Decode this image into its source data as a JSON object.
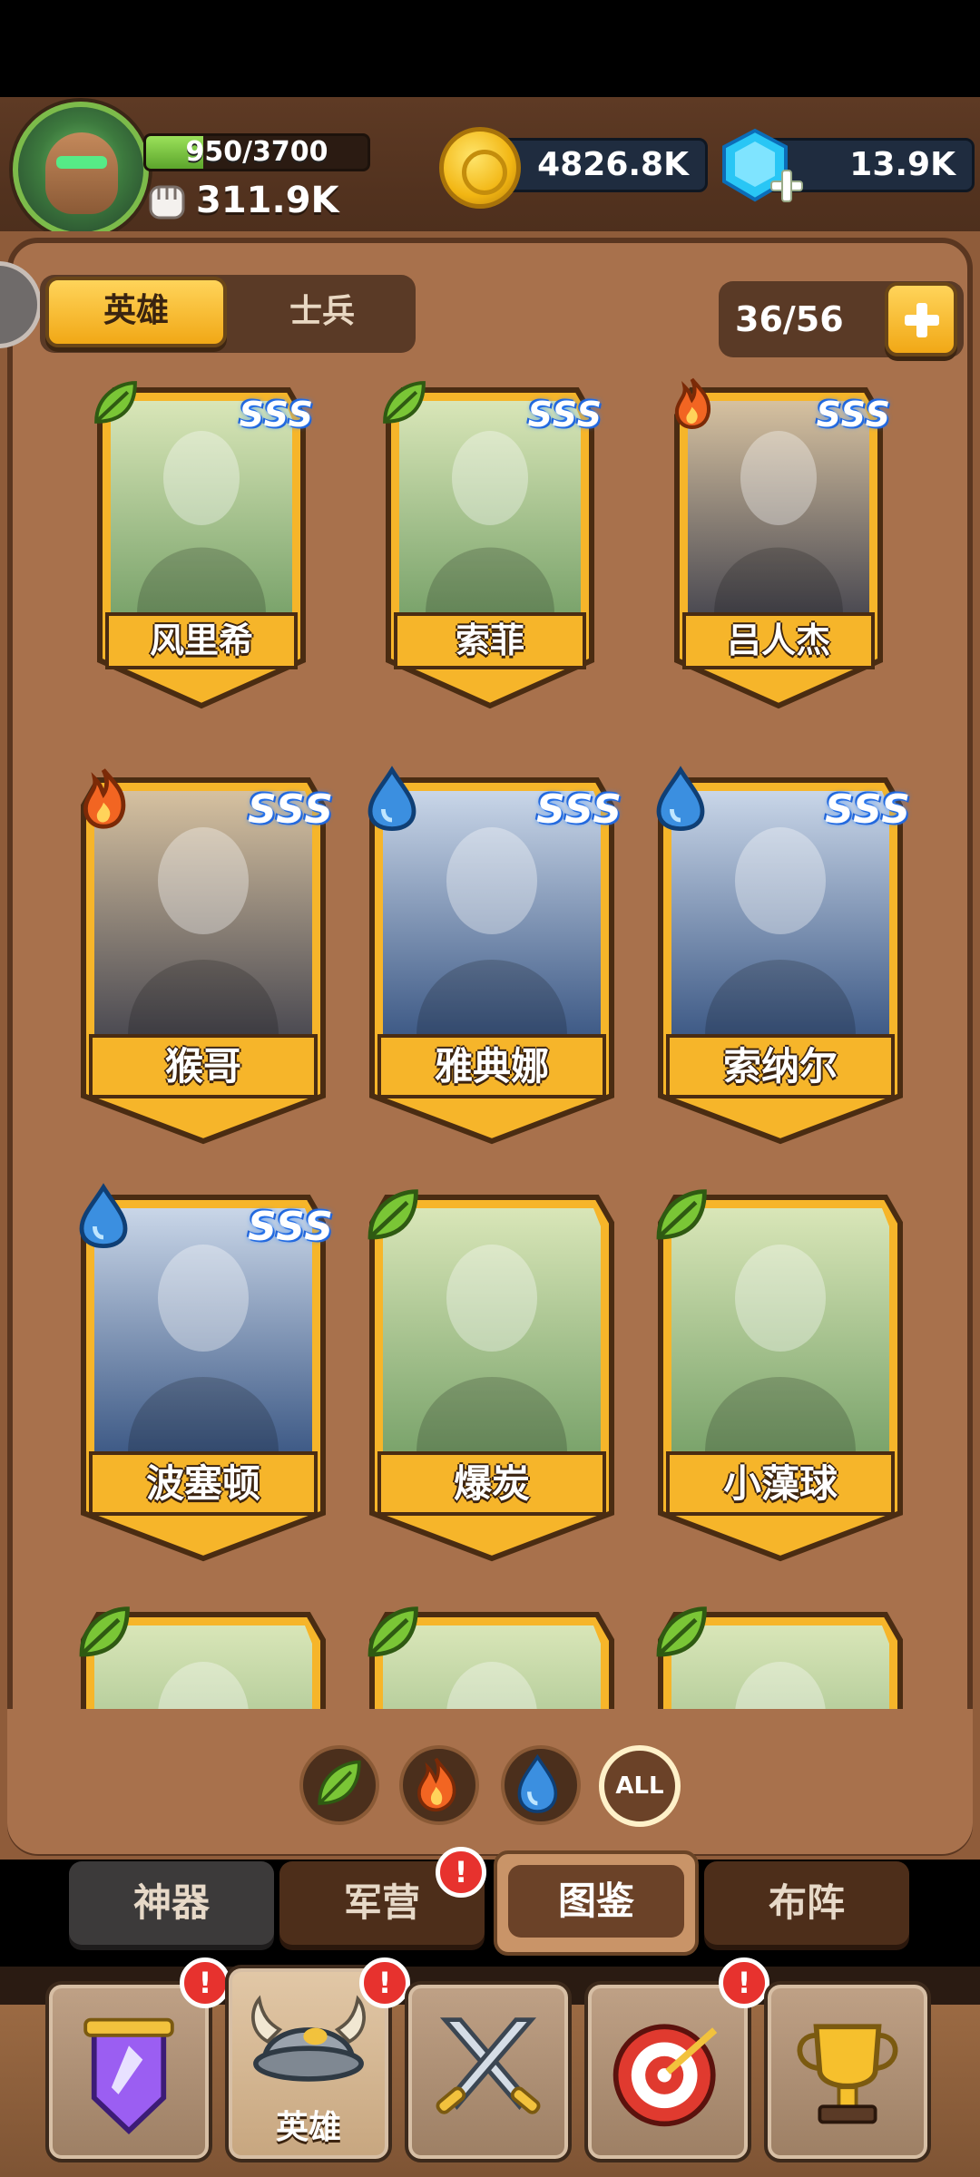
{
  "player": {
    "xp_text": "950/3700",
    "xp_fraction": 0.2568,
    "power_text": "311.9K"
  },
  "currency": {
    "gold": "4826.8K",
    "gems": "13.9K"
  },
  "tabs": {
    "hero": "英雄",
    "soldier": "士兵"
  },
  "collection_count": "36/56",
  "heroes": [
    {
      "name": "风里希",
      "element": "leaf",
      "rank": "SSS"
    },
    {
      "name": "索菲",
      "element": "leaf",
      "rank": "SSS"
    },
    {
      "name": "吕人杰",
      "element": "fire",
      "rank": "SSS"
    },
    {
      "name": "猴哥",
      "element": "fire",
      "rank": "SSS"
    },
    {
      "name": "雅典娜",
      "element": "water",
      "rank": "SSS"
    },
    {
      "name": "索纳尔",
      "element": "water",
      "rank": "SSS"
    },
    {
      "name": "波塞顿",
      "element": "water",
      "rank": "SSS"
    },
    {
      "name": "爆炭",
      "element": "leaf",
      "rank": ""
    },
    {
      "name": "小藻球",
      "element": "leaf",
      "rank": ""
    },
    {
      "name": "",
      "element": "leaf",
      "rank": ""
    },
    {
      "name": "",
      "element": "leaf",
      "rank": ""
    },
    {
      "name": "",
      "element": "leaf",
      "rank": ""
    }
  ],
  "filters": {
    "all_label": "ALL",
    "items": [
      "leaf-filter",
      "fire-filter",
      "water-filter"
    ]
  },
  "subtabs": {
    "artifact": "神器",
    "barracks": "军营",
    "codex": "图鉴",
    "formation": "布阵"
  },
  "bottom_nav": {
    "hero_label": "英雄",
    "badge_text": "!"
  },
  "colors": {
    "leaf": "#7ac636",
    "fire": "#f26522",
    "water": "#3b8fe0",
    "card_gold": "#f6b52a",
    "panel": "#a8714c"
  }
}
